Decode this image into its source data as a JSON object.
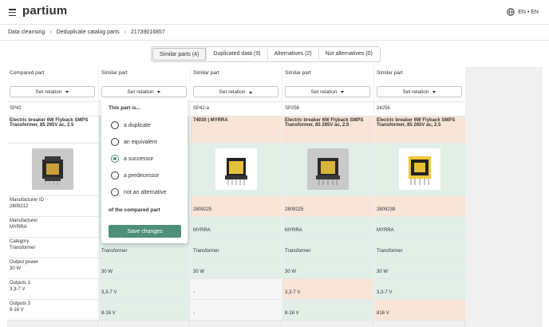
{
  "header": {
    "brand": "partium",
    "language": "EN • EN"
  },
  "breadcrumb": [
    "Data cleansing",
    "Deduplicate catalog parts",
    "21739016857"
  ],
  "tabs": [
    "Similar parts (4)",
    "Duplicated data (9)",
    "Alternatives (2)",
    "Not alternatives (0)"
  ],
  "columns": [
    {
      "header": "Compared part",
      "button": "Set relation",
      "part_id": "SP42",
      "description": "Electric breaker 6W Flyback SMPS Transformer, 85 265V ac, 2.5",
      "manufacturer_id_label": "Manufacturer ID",
      "manufacturer_id": "2809212",
      "manufacturer_label": "Manufacturer",
      "manufacturer": "MYRRA",
      "category_label": "Category",
      "category": "Transformer",
      "output_power_label": "Output power",
      "output_power": "30 W",
      "outputs1_label": "Outputs 1",
      "outputs1": "3,3-7 V",
      "outputs3_label": "Outputs 3",
      "outputs3": "8-16 V"
    },
    {
      "header": "Similar part",
      "button": "Set relation",
      "category": "Transformer",
      "output_power": "30 W",
      "outputs1": "3,3-7 V",
      "outputs3": "8-16 V"
    },
    {
      "header": "Similar part",
      "button": "Set relation",
      "part_id": "SP42-a",
      "description": "74030 | MYRRA",
      "manufacturer_id": "2809225",
      "manufacturer": "MYRRA",
      "category": "Transformer",
      "output_power": "30 W",
      "outputs1": "-",
      "outputs3": "-"
    },
    {
      "header": "Similar part",
      "button": "Set relation",
      "part_id": "SP256",
      "description": "Electric breaker 6W Flyback SMPS Transformer, 85 265V ac, 2.5",
      "manufacturer_id": "2809225",
      "manufacturer": "MYRRA",
      "category": "Transformer",
      "output_power": "30 W",
      "outputs1": "3,3-7 V",
      "outputs3": "8-16 V"
    },
    {
      "header": "Similar part",
      "button": "Set relation",
      "part_id": "24256",
      "description": "Electric breaker 6W Flyback SMPS Transformer, 85 265V ac, 2.5",
      "manufacturer_id": "2809238",
      "manufacturer": "MYRRA",
      "category": "Transformer",
      "output_power": "30 W",
      "outputs1": "3,3-7 V",
      "outputs3": "816 V"
    }
  ],
  "popup": {
    "title": "This part is...",
    "options": [
      "a duplicate",
      "an equivalent",
      "a successor",
      "a predecessor",
      "not an alternative"
    ],
    "selected": "a successor",
    "footer": "of the compared part",
    "save": "Save changes"
  },
  "colors": {
    "match": "#e1efe8",
    "mismatch": "#f8e5d8",
    "accent": "#4e8f7a"
  },
  "icons": [
    "menu-icon",
    "globe-icon",
    "chevron-right-icon",
    "caret-down-icon",
    "caret-up-icon",
    "transformer-image"
  ]
}
